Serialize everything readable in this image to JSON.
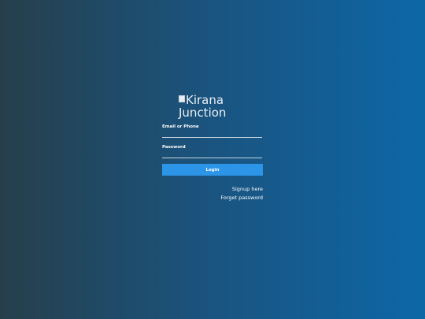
{
  "logo": {
    "alt_line1": "Kirana",
    "alt_line2": "Junction"
  },
  "form": {
    "email_label": "Email or Phone",
    "email_value": "",
    "password_label": "Password",
    "password_value": "",
    "login_label": "Login"
  },
  "links": {
    "signup": "Signup here",
    "forgot": "Forget password"
  }
}
